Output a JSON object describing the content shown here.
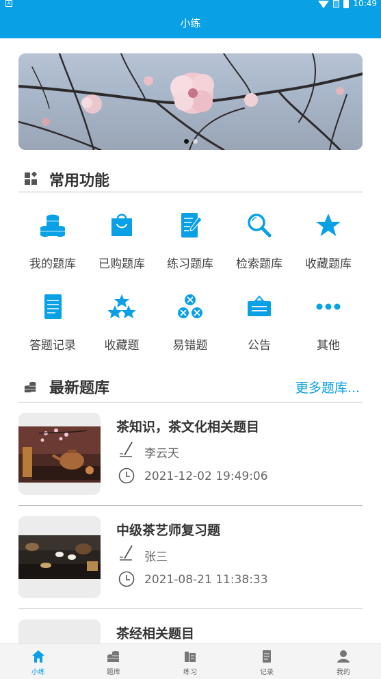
{
  "status_bar": {
    "left_badge": "A",
    "time": "10:49"
  },
  "header": {
    "title": "小练"
  },
  "banner": {
    "slides": 2,
    "active_index": 0
  },
  "common_functions": {
    "title": "常用功能",
    "items": [
      {
        "label": "我的题库",
        "icon": "database-stack-icon"
      },
      {
        "label": "已购题库",
        "icon": "shopping-bag-icon"
      },
      {
        "label": "练习题库",
        "icon": "notepad-pen-icon"
      },
      {
        "label": "检索题库",
        "icon": "magnifier-icon"
      },
      {
        "label": "收藏题库",
        "icon": "star-icon"
      },
      {
        "label": "答题记录",
        "icon": "document-list-icon"
      },
      {
        "label": "收藏题",
        "icon": "three-stars-icon"
      },
      {
        "label": "易错题",
        "icon": "three-crosses-icon"
      },
      {
        "label": "公告",
        "icon": "notice-board-icon"
      },
      {
        "label": "其他",
        "icon": "more-dots-icon"
      }
    ]
  },
  "latest": {
    "title": "最新题库",
    "more_label": "更多题库...",
    "items": [
      {
        "title": "茶知识，茶文化相关题目",
        "author": "李云天",
        "time": "2021-12-02 19:49:06"
      },
      {
        "title": "中级茶艺师复习题",
        "author": "张三",
        "time": "2021-08-21 11:38:33"
      },
      {
        "title": "茶经相关题目",
        "author": "",
        "time": ""
      }
    ]
  },
  "tab_bar": {
    "active": 0,
    "tabs": [
      {
        "label": "小练"
      },
      {
        "label": "题库"
      },
      {
        "label": "练习"
      },
      {
        "label": "记录"
      },
      {
        "label": "我的"
      }
    ]
  },
  "colors": {
    "accent": "#0aa0e6",
    "text": "#333333",
    "divider": "#bdbdbd"
  }
}
